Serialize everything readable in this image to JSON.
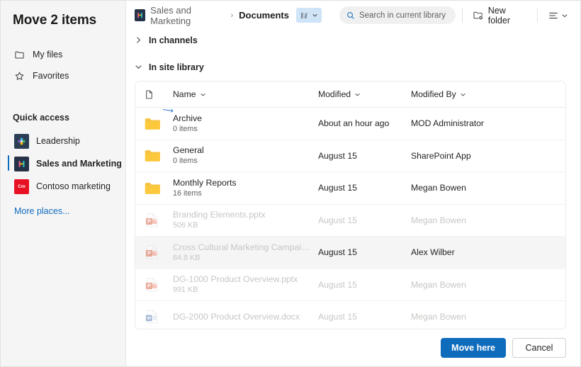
{
  "dialog": {
    "title": "Move 2 items"
  },
  "sidebar": {
    "nav": [
      {
        "label": "My files",
        "icon": "folder-icon"
      },
      {
        "label": "Favorites",
        "icon": "star-icon"
      }
    ],
    "quick_access_heading": "Quick access",
    "quick_access": [
      {
        "label": "Leadership",
        "icon": "site-icon",
        "selected": false
      },
      {
        "label": "Sales and Marketing",
        "icon": "site-icon",
        "selected": true
      },
      {
        "label": "Contoso marketing",
        "icon": "site-icon",
        "badge": "Cm",
        "selected": false
      }
    ],
    "more_places": "More places...",
    "accent": "#0f6cbd"
  },
  "command_bar": {
    "breadcrumb": [
      {
        "label": "Sales and Marketing",
        "current": false
      },
      {
        "label": "Documents",
        "current": true
      }
    ],
    "separator": "›",
    "library_picker": {
      "icon": "library-icon",
      "chevron": "chevron-down-icon"
    },
    "search": {
      "placeholder": "Search in current library",
      "icon": "search-icon"
    },
    "new_folder": {
      "label": "New folder",
      "icon": "new-folder-icon"
    },
    "view_options": {
      "icon": "list-view-icon",
      "chevron": "chevron-down-icon"
    }
  },
  "sections": [
    {
      "label": "In channels",
      "expanded": false,
      "chevron": "chevron-right-icon"
    },
    {
      "label": "In site library",
      "expanded": true,
      "chevron": "chevron-down-icon"
    }
  ],
  "table": {
    "columns": [
      {
        "label": "",
        "icon": "file-type-icon"
      },
      {
        "label": "Name",
        "sortable": true
      },
      {
        "label": "Modified",
        "sortable": true
      },
      {
        "label": "Modified By",
        "sortable": true
      }
    ],
    "rows": [
      {
        "name": "Archive",
        "sub": "0 items",
        "modified": "About an hour ago",
        "modified_by": "MOD Administrator",
        "kind": "folder",
        "disabled": false,
        "highlighted": false,
        "cursor": true
      },
      {
        "name": "General",
        "sub": "0 items",
        "modified": "August 15",
        "modified_by": "SharePoint App",
        "kind": "folder",
        "disabled": false,
        "highlighted": false,
        "cursor": false
      },
      {
        "name": "Monthly Reports",
        "sub": "16 items",
        "modified": "August 15",
        "modified_by": "Megan Bowen",
        "kind": "folder",
        "disabled": false,
        "highlighted": false,
        "cursor": false
      },
      {
        "name": "Branding Elements.pptx",
        "sub": "506 KB",
        "modified": "August 15",
        "modified_by": "Megan Bowen",
        "kind": "powerpoint",
        "disabled": true,
        "highlighted": false,
        "cursor": false
      },
      {
        "name": "Cross Cultural Marketing Campaigns.p…",
        "sub": "84.8 KB",
        "modified": "August 15",
        "modified_by": "Alex Wilber",
        "kind": "powerpoint",
        "disabled": true,
        "highlighted": true,
        "cursor": false
      },
      {
        "name": "DG-1000 Product Overview.pptx",
        "sub": "991 KB",
        "modified": "August 15",
        "modified_by": "Megan Bowen",
        "kind": "powerpoint",
        "disabled": true,
        "highlighted": false,
        "cursor": false
      },
      {
        "name": "DG-2000 Product Overview.docx",
        "sub": "",
        "modified": "August 15",
        "modified_by": "Megan Bowen",
        "kind": "word",
        "disabled": true,
        "highlighted": false,
        "cursor": false
      }
    ]
  },
  "footer": {
    "primary": "Move here",
    "secondary": "Cancel"
  }
}
